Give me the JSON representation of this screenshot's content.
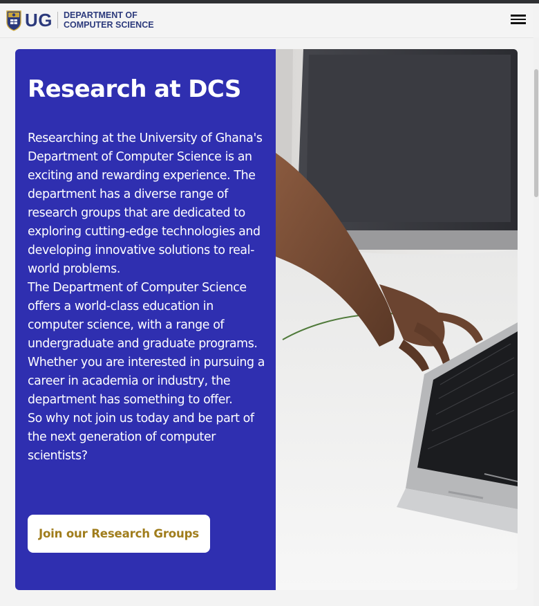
{
  "header": {
    "logo_mark": "UG",
    "dept_line1": "DEPARTMENT OF",
    "dept_line2": "COMPUTER SCIENCE",
    "menu_icon": "hamburger-menu-icon"
  },
  "hero": {
    "title": "Research at DCS",
    "paragraphs": [
      "Researching at the University of Ghana's Department of Computer Science is an exciting and rewarding experience. The department has a diverse range of research groups that are dedicated to exploring cutting-edge technologies and developing innovative solutions to real-world problems.",
      "The Department of Computer Science offers a world-class education in computer science, with a range of undergraduate and graduate programs. Whether you are interested in pursuing a career in academia or industry, the department has something to offer.",
      "So why not join us today and be part of the next generation of computer scientists?"
    ],
    "cta_label": "Join our Research Groups",
    "image": "hands-typing-on-laptop-photo"
  },
  "colors": {
    "panel_bg": "#2f2fb0",
    "cta_text": "#a07d1c",
    "logo_navy": "#2c3a7c"
  }
}
